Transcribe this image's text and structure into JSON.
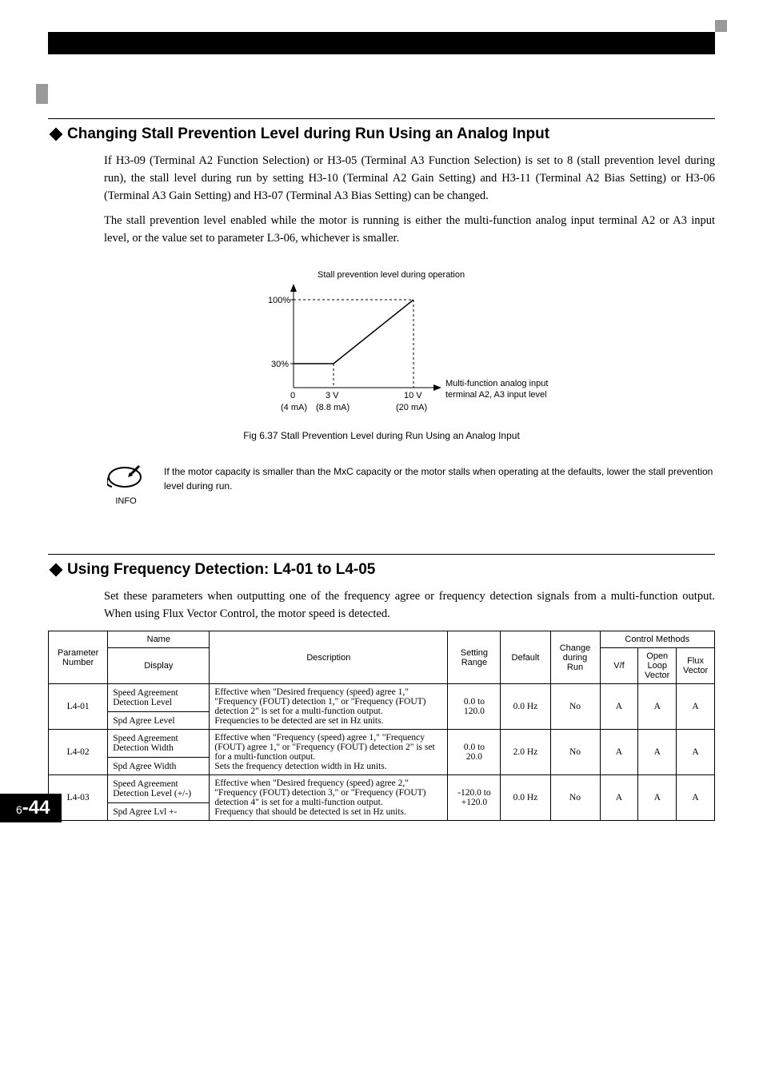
{
  "section1": {
    "heading": "Changing Stall Prevention Level during Run Using an Analog Input",
    "para1": "If H3-09 (Terminal A2 Function Selection) or H3-05 (Terminal A3 Function Selection) is set to 8 (stall prevention level during run), the stall level during run by setting H3-10 (Terminal A2 Gain Setting) and H3-11 (Terminal A2 Bias Setting) or H3-06 (Terminal A3 Gain Setting) and H3-07 (Terminal A3 Bias Setting) can be changed.",
    "para2": "The stall prevention level enabled while the motor is running is either the multi-function analog input terminal A2 or A3 input level, or the value set to parameter L3-06, whichever is smaller."
  },
  "chart_data": {
    "type": "line",
    "title": "Stall prevention level during operation",
    "xlabel": "Multi-function analog input terminal A2, A3 input level",
    "ylabel": "",
    "x_ticks_v": [
      "0",
      "3 V",
      "10 V"
    ],
    "x_ticks_ma": [
      "(4 mA)",
      "(8.8 mA)",
      "(20 mA)"
    ],
    "y_ticks_pct": [
      "30%",
      "100%"
    ],
    "series": [
      {
        "name": "Stall prevention level",
        "points": [
          [
            0,
            30
          ],
          [
            3,
            30
          ],
          [
            10,
            100
          ]
        ]
      }
    ],
    "xlim_v": [
      0,
      10
    ],
    "ylim_pct": [
      0,
      100
    ]
  },
  "figure_caption": "Fig 6.37  Stall Prevention Level during Run Using an Analog Input",
  "info_note": {
    "label": "INFO",
    "text": "If the motor capacity is smaller than the MxC capacity or the motor stalls when operating at the defaults, lower the stall prevention level during run."
  },
  "section2": {
    "heading": "Using Frequency Detection: L4-01 to L4-05",
    "para": "Set these parameters when outputting one of the frequency agree or frequency detection signals from a multi-function output. When using Flux Vector Control, the motor speed is detected."
  },
  "table": {
    "headers": {
      "param_no": "Parameter Number",
      "name": "Name",
      "display": "Display",
      "description": "Description",
      "range": "Setting Range",
      "default": "Default",
      "change": "Change during Run",
      "control": "Control Methods",
      "vf": "V/f",
      "olv": "Open Loop Vector",
      "flux": "Flux Vector"
    },
    "rows": [
      {
        "num": "L4-01",
        "name": "Speed Agreement Detection Level",
        "display": "Spd Agree Level",
        "desc": "Effective when \"Desired frequency (speed) agree 1,\" \"Frequency (FOUT) detection 1,\" or \"Frequency (FOUT) detection 2\" is set for a multi-function output.\nFrequencies to be detected are set in Hz units.",
        "range": "0.0 to 120.0",
        "default": "0.0 Hz",
        "change": "No",
        "vf": "A",
        "olv": "A",
        "flux": "A"
      },
      {
        "num": "L4-02",
        "name": "Speed Agreement Detection Width",
        "display": "Spd Agree Width",
        "desc": "Effective when \"Frequency (speed) agree 1,\" \"Frequency (FOUT) agree 1,\" or \"Frequency (FOUT) detection 2\" is set for a multi-function output.\nSets the frequency detection width in Hz units.",
        "range": "0.0 to 20.0",
        "default": "2.0 Hz",
        "change": "No",
        "vf": "A",
        "olv": "A",
        "flux": "A"
      },
      {
        "num": "L4-03",
        "name": "Speed Agreement Detection Level (+/-)",
        "display": "Spd Agree Lvl +-",
        "desc": "Effective when \"Desired frequency (speed) agree 2,\" \"Frequency (FOUT) detection 3,\" or \"Frequency (FOUT) detection 4\" is set for a multi-function output.\nFrequency that should be detected is set in Hz units.",
        "range": "-120.0 to +120.0",
        "default": "0.0 Hz",
        "change": "No",
        "vf": "A",
        "olv": "A",
        "flux": "A"
      }
    ]
  },
  "page_number": {
    "chapter": "6",
    "sep": "-",
    "page": "44"
  }
}
